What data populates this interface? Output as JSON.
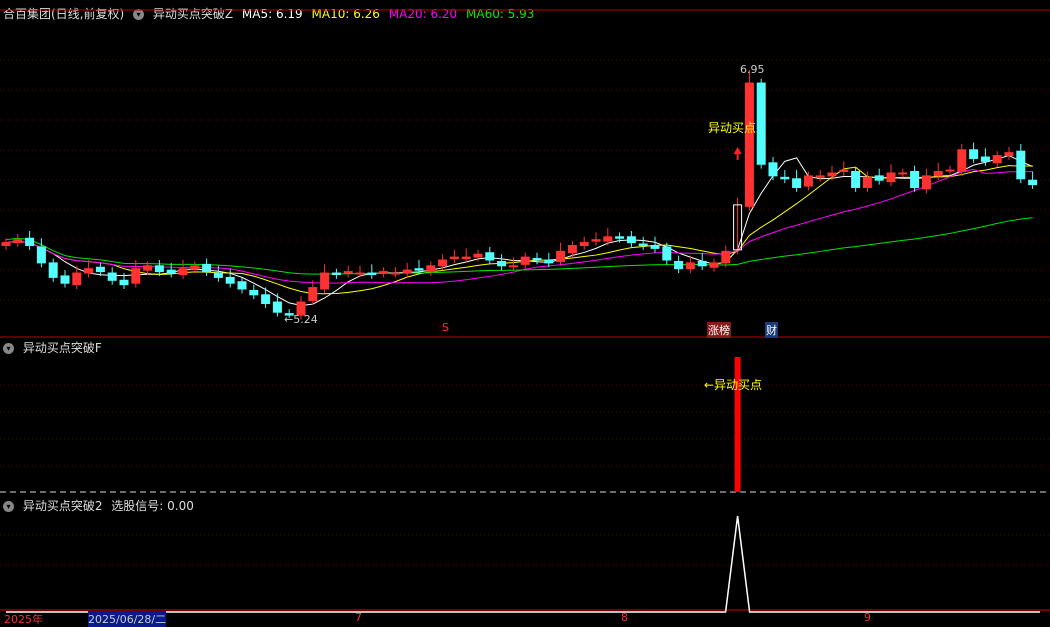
{
  "header": {
    "title": "合百集团(日线,前复权)",
    "indicator": "异动买点突破Z",
    "ma5": "MA5: 6.19",
    "ma10": "MA10: 6.26",
    "ma20": "MA20: 6.20",
    "ma60": "MA60: 5.93"
  },
  "panel2": {
    "title": "异动买点突破F",
    "signal_label": "←异动买点"
  },
  "panel3": {
    "title": "异动买点突破2",
    "value": "选股信号: 0.00"
  },
  "main": {
    "high_label": "6.95",
    "low_label": "←5.24",
    "signal_text": "异动买点",
    "s_mark": "S",
    "badge_limit_up": "涨榜",
    "badge_finance": "财"
  },
  "axis": {
    "labels": [
      "2025年",
      "2025/06/28/二",
      "7",
      "8",
      "9"
    ]
  },
  "colors": {
    "up": "#ff3232",
    "down": "#54ffff",
    "ma5": "#ffffff",
    "ma10": "#ffff00",
    "ma20": "#ff00ff",
    "ma60": "#00e600"
  },
  "closes": [
    5.76,
    5.78,
    5.74,
    5.62,
    5.52,
    5.48,
    5.55,
    5.58,
    5.56,
    5.5,
    5.47,
    5.58,
    5.6,
    5.56,
    5.55,
    5.58,
    5.6,
    5.56,
    5.52,
    5.48,
    5.44,
    5.4,
    5.34,
    5.28,
    5.26,
    5.35,
    5.45,
    5.55,
    5.54,
    5.56,
    5.55,
    5.54,
    5.56,
    5.55,
    5.57,
    5.57,
    5.6,
    5.64,
    5.66,
    5.66,
    5.68,
    5.64,
    5.6,
    5.6,
    5.66,
    5.64,
    5.62,
    5.7,
    5.74,
    5.76,
    5.78,
    5.8,
    5.79,
    5.76,
    5.74,
    5.72,
    5.64,
    5.58,
    5.62,
    5.6,
    5.62,
    5.7,
    6.02,
    6.86,
    6.3,
    6.22,
    6.2,
    6.14,
    6.22,
    6.22,
    6.24,
    6.26,
    6.14,
    6.21,
    6.19,
    6.24,
    6.24,
    6.14,
    6.22,
    6.25,
    6.26,
    6.4,
    6.34,
    6.32,
    6.36,
    6.38,
    6.2,
    6.16
  ],
  "signal_index": 62
}
